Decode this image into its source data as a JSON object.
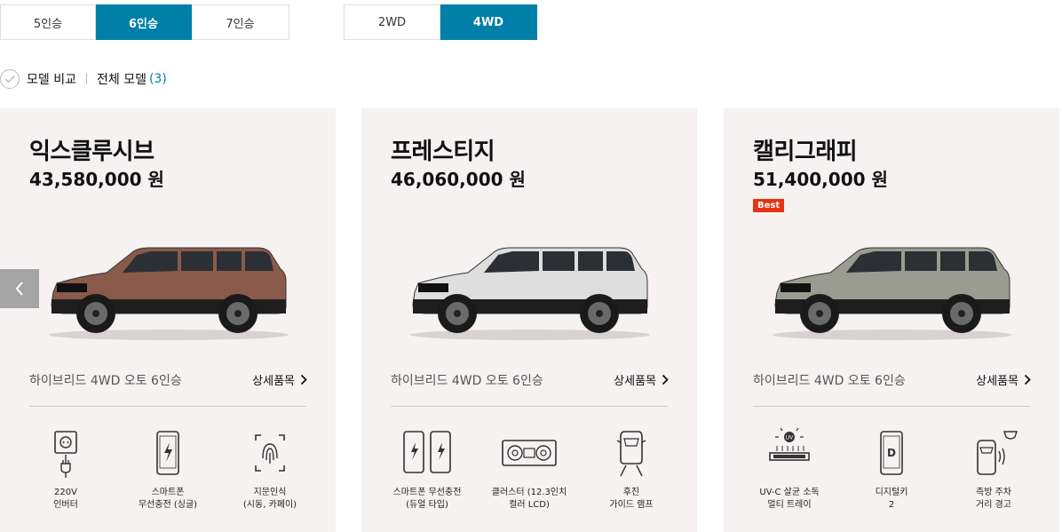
{
  "seat_filter": {
    "options": [
      "5인승",
      "6인승",
      "7인승"
    ],
    "selected": "6인승"
  },
  "drive_filter": {
    "options": [
      "2WD",
      "4WD"
    ],
    "selected": "4WD"
  },
  "compare": {
    "label": "모델 비교",
    "all_models_label": "전체 모델",
    "count": "(3)"
  },
  "cards": [
    {
      "name": "익스클루시브",
      "price": "43,580,000 원",
      "badge": "",
      "trim": "하이브리드 4WD 오토 6인승",
      "detail_link": "상세품목",
      "car_color": "#8a5a4a",
      "features": [
        {
          "icon": "power-outlet-icon",
          "text": "220V\n인버터"
        },
        {
          "icon": "phone-wireless-charge-icon",
          "text": "스마트폰\n무선충전 (싱글)"
        },
        {
          "icon": "fingerprint-icon",
          "text": "지문인식\n(시동, 카페이)"
        }
      ]
    },
    {
      "name": "프레스티지",
      "price": "46,060,000 원",
      "badge": "",
      "trim": "하이브리드 4WD 오토 6인승",
      "detail_link": "상세품목",
      "car_color": "#dedede",
      "features": [
        {
          "icon": "dual-phone-charge-icon",
          "text": "스마트폰 무선충전\n(듀얼 타입)"
        },
        {
          "icon": "cluster-display-icon",
          "text": "클러스터 (12.3인치\n컬러 LCD)"
        },
        {
          "icon": "rear-guide-lamp-icon",
          "text": "후진\n가이드 램프"
        }
      ]
    },
    {
      "name": "캘리그래피",
      "price": "51,400,000 원",
      "badge": "Best",
      "trim": "하이브리드 4WD 오토 6인승",
      "detail_link": "상세품목",
      "car_color": "#9a9c92",
      "features": [
        {
          "icon": "uvc-tray-icon",
          "text": "UV-C 살균 소독\n멀티 트레이"
        },
        {
          "icon": "digital-key-icon",
          "text": "디지털키\n2"
        },
        {
          "icon": "side-parking-sensor-icon",
          "text": "측방 주차\n거리 경고"
        }
      ]
    }
  ],
  "colors": {
    "accent": "#007fa8",
    "badge": "#e63312",
    "card_bg": "#f5f2f1"
  }
}
